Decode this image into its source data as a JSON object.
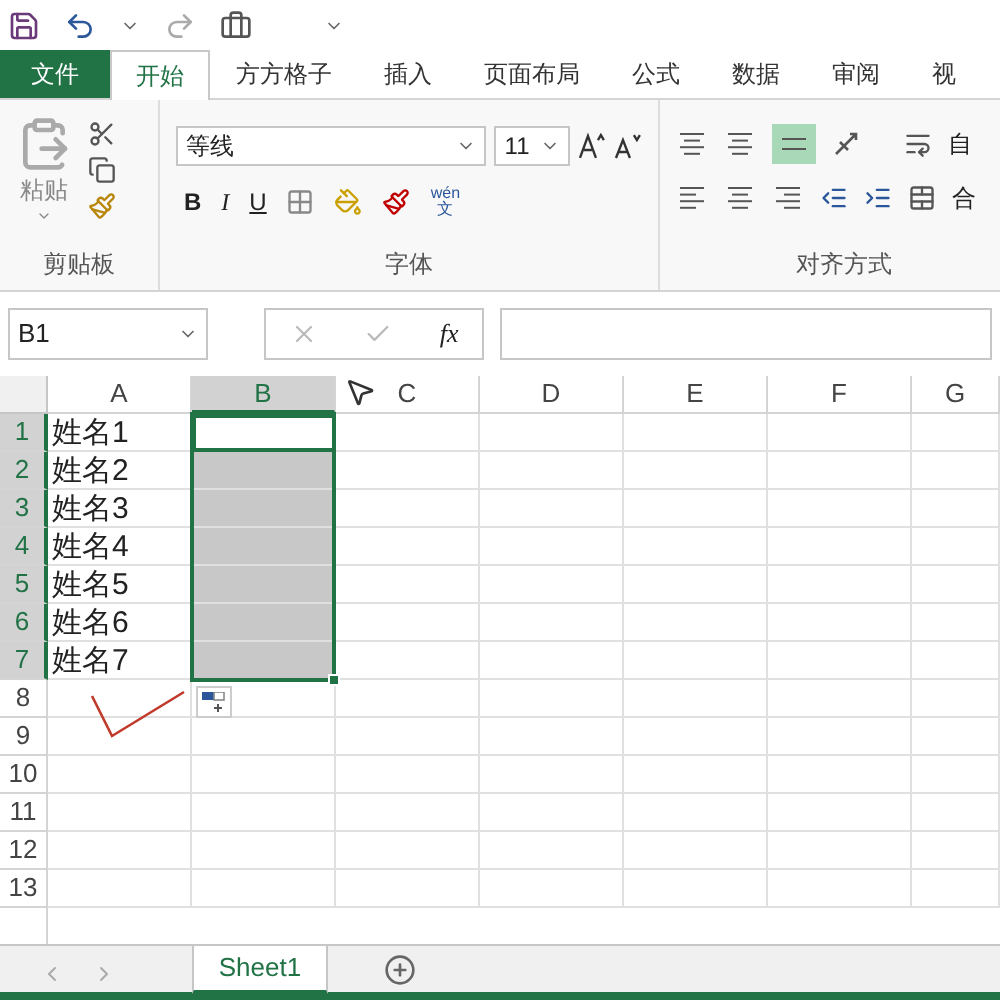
{
  "ribbon_tabs": [
    {
      "label": "文件",
      "kind": "file",
      "selected": false
    },
    {
      "label": "开始",
      "kind": "tab",
      "selected": true
    },
    {
      "label": "方方格子",
      "kind": "tab",
      "selected": false
    },
    {
      "label": "插入",
      "kind": "tab",
      "selected": false
    },
    {
      "label": "页面布局",
      "kind": "tab",
      "selected": false
    },
    {
      "label": "公式",
      "kind": "tab",
      "selected": false
    },
    {
      "label": "数据",
      "kind": "tab",
      "selected": false
    },
    {
      "label": "审阅",
      "kind": "tab",
      "selected": false
    },
    {
      "label": "视",
      "kind": "tab",
      "selected": false
    }
  ],
  "ribbon": {
    "paste_label": "粘贴",
    "font_name": "等线",
    "font_size": "11",
    "bold": "B",
    "italic": "I",
    "underline": "U",
    "phonetic_top": "wén",
    "phonetic_bottom": "文",
    "wrap_text": "自",
    "merge": "合",
    "groups": [
      "剪贴板",
      "字体",
      "对齐方式"
    ]
  },
  "formula_bar": {
    "name_box": "B1",
    "fx": "fx"
  },
  "columns": [
    {
      "label": "A",
      "selected": false
    },
    {
      "label": "B",
      "selected": true
    },
    {
      "label": "C",
      "selected": false
    },
    {
      "label": "D",
      "selected": false
    },
    {
      "label": "E",
      "selected": false
    },
    {
      "label": "F",
      "selected": false
    },
    {
      "label": "G",
      "selected": false
    }
  ],
  "rows": [
    {
      "label": "1",
      "selected": true,
      "active": true,
      "name": "姓名1"
    },
    {
      "label": "2",
      "selected": true,
      "active": false,
      "name": "姓名2"
    },
    {
      "label": "3",
      "selected": true,
      "active": false,
      "name": "姓名3"
    },
    {
      "label": "4",
      "selected": true,
      "active": false,
      "name": "姓名4"
    },
    {
      "label": "5",
      "selected": true,
      "active": false,
      "name": "姓名5"
    },
    {
      "label": "6",
      "selected": true,
      "active": false,
      "name": "姓名6"
    },
    {
      "label": "7",
      "selected": true,
      "active": false,
      "name": "姓名7"
    },
    {
      "label": "8",
      "selected": false,
      "active": false
    },
    {
      "label": "9",
      "selected": false,
      "active": false
    },
    {
      "label": "10",
      "selected": false,
      "active": false
    },
    {
      "label": "11",
      "selected": false,
      "active": false
    },
    {
      "label": "12",
      "selected": false,
      "active": false
    },
    {
      "label": "13",
      "selected": false,
      "active": false
    }
  ],
  "sheet_tabs": [
    {
      "label": "Sheet1",
      "selected": true
    }
  ]
}
